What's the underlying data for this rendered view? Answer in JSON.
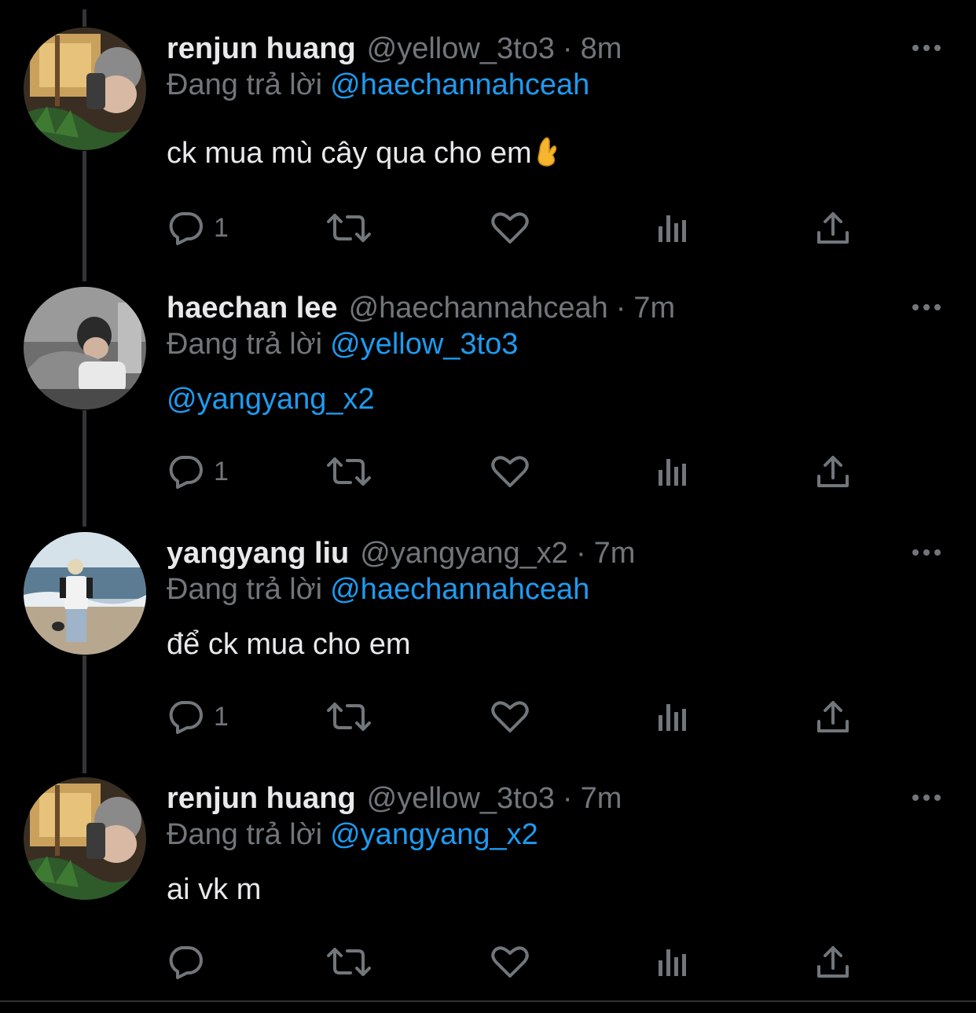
{
  "theme": {
    "background": "#000000",
    "text_primary": "#e7e9ea",
    "text_secondary": "#71767b",
    "accent": "#1d9bf0",
    "thread_line": "#333639"
  },
  "replying_label": "Đang trả lời",
  "tweets": [
    {
      "name": "renjun huang",
      "handle": "@yellow_3to3",
      "separator": "·",
      "time": "8m",
      "replying_to": "@haechannahceah",
      "text": "ck mua mù cây qua cho em",
      "emoji": "crossed-fingers-emoji",
      "avatar": "selfie-plant-avatar",
      "reply_count": "1"
    },
    {
      "name": "haechan lee",
      "handle": "@haechannahceah",
      "separator": "·",
      "time": "7m",
      "replying_to": "@yellow_3to3",
      "mention_text": "@yangyang_x2",
      "avatar": "reclining-person-avatar",
      "reply_count": "1"
    },
    {
      "name": "yangyang liu",
      "handle": "@yangyang_x2",
      "separator": "·",
      "time": "7m",
      "replying_to": "@haechannahceah",
      "text": "để ck mua cho em",
      "avatar": "beach-person-avatar",
      "reply_count": "1"
    },
    {
      "name": "renjun huang",
      "handle": "@yellow_3to3",
      "separator": "·",
      "time": "7m",
      "replying_to": "@yangyang_x2",
      "text": "ai vk m",
      "avatar": "selfie-plant-avatar",
      "reply_count": ""
    }
  ],
  "icons": [
    "reply-icon",
    "retweet-icon",
    "like-icon",
    "views-icon",
    "share-icon",
    "more-icon"
  ]
}
